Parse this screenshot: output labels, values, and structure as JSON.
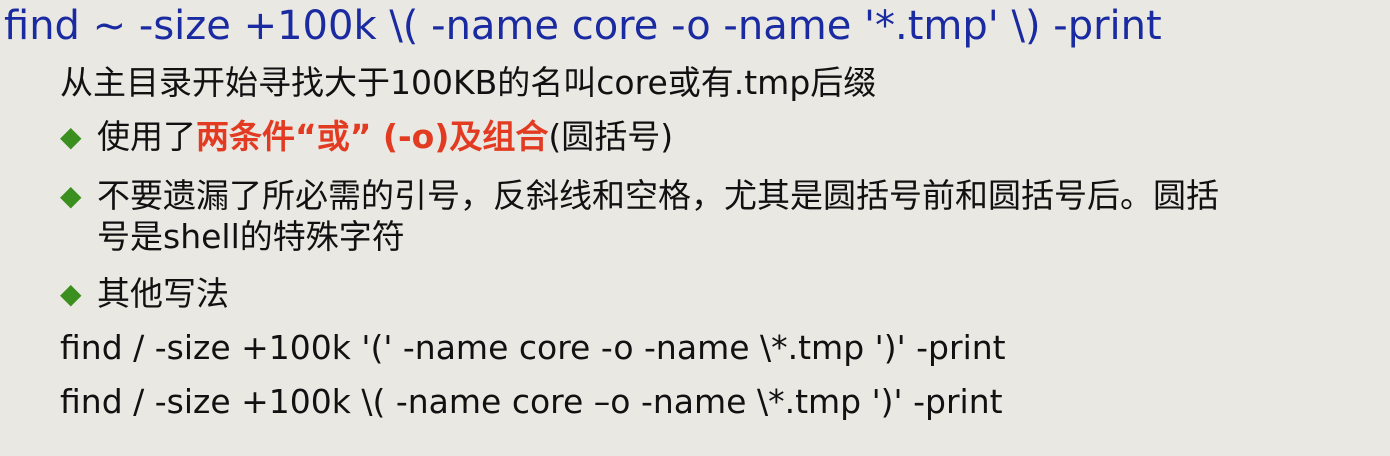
{
  "title": "find ~ -size +100k \\( -name core -o -name '*.tmp' \\) -print",
  "lines": {
    "desc": "从主目录开始寻找大于100KB的名叫core或有.tmp后缀",
    "bullet1": {
      "before": "使用了",
      "highlight": "两条件“或” (-o)及组合",
      "after": "(圆括号)"
    },
    "bullet2_line1": "不要遗漏了所必需的引号，反斜线和空格，尤其是圆括号前和圆括号后。圆括",
    "bullet2_line2": "号是shell的特殊字符",
    "bullet3": "其他写法",
    "cmd1": "find / -size +100k '(' -name core -o -name \\*.tmp ')' -print",
    "cmd2": "find / -size +100k  \\( -name core –o -name \\*.tmp ')' -print"
  },
  "bullet_glyph": "◆",
  "colors": {
    "background": "#eae8e3",
    "title": "#1a2aa0",
    "text": "#111111",
    "highlight": "#e23b22",
    "bullet": "#3b8f1e"
  }
}
